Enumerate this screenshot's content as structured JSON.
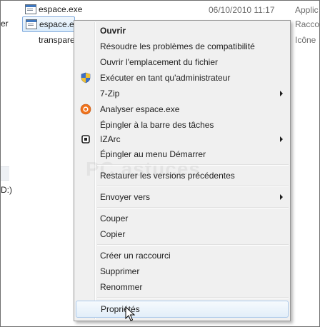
{
  "left_pane": {
    "text_1": "er",
    "text_2": "D:)"
  },
  "files": [
    {
      "name": "espace.exe",
      "date": "06/10/2010 11:17",
      "type": "Applic"
    },
    {
      "name": "espace.exe",
      "type": "Racco"
    },
    {
      "name": "transpare",
      "type": "Icône"
    }
  ],
  "watermark": "PC astuces",
  "context_menu": {
    "items": {
      "open": "Ouvrir",
      "compat": "Résoudre les problèmes de compatibilité",
      "open_location": "Ouvrir l'emplacement du fichier",
      "run_admin": "Exécuter en tant qu'administrateur",
      "sevenzip": "7-Zip",
      "scan": "Analyser espace.exe",
      "pin_taskbar": "Épingler à la barre des tâches",
      "izarc": "IZArc",
      "pin_start": "Épingler au menu Démarrer",
      "restore": "Restaurer les versions précédentes",
      "send_to": "Envoyer vers",
      "cut": "Couper",
      "copy": "Copier",
      "shortcut": "Créer un raccourci",
      "delete": "Supprimer",
      "rename": "Renommer",
      "properties": "Propriétés"
    },
    "icons": {
      "run_admin": "uac-shield-icon",
      "scan": "antivirus-scan-icon",
      "izarc": "izarc-icon"
    }
  },
  "colors": {
    "menu_bg": "#f0f0f0",
    "selection_border": "#84acdd",
    "hover_border": "#aac8ea"
  }
}
